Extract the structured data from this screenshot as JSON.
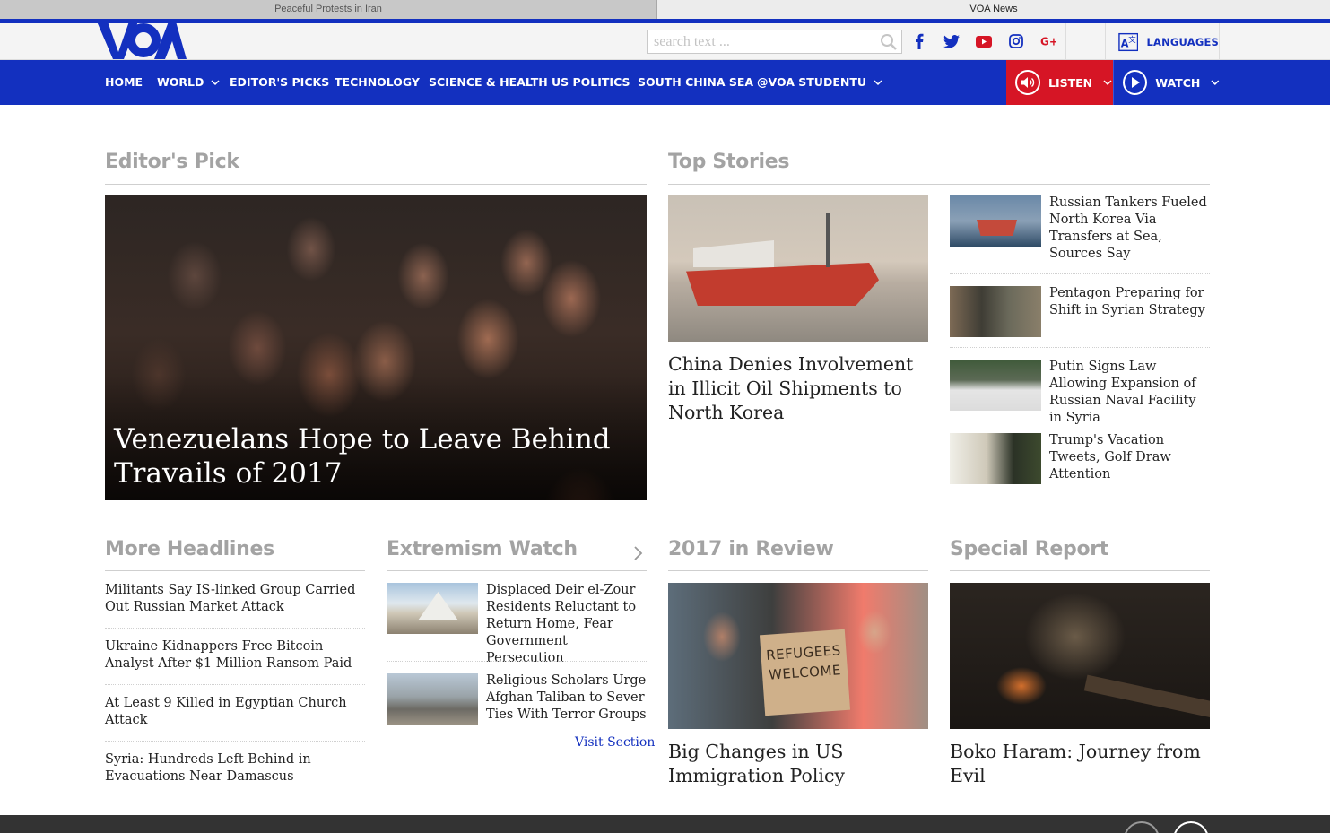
{
  "browser": {
    "tabs": [
      {
        "title": "Peaceful Protests in Iran",
        "active": false
      },
      {
        "title": "VOA News",
        "active": true
      }
    ]
  },
  "header": {
    "logo": "VOA",
    "search_placeholder": "search text ...",
    "social": [
      "facebook-icon",
      "twitter-icon",
      "youtube-icon",
      "instagram-icon",
      "google-plus-icon"
    ],
    "languages_label": "LANGUAGES"
  },
  "nav": {
    "items": [
      {
        "label": "HOME",
        "dropdown": false
      },
      {
        "label": "WORLD",
        "dropdown": true
      },
      {
        "label": "EDITOR'S PICKS",
        "dropdown": false
      },
      {
        "label": "TECHNOLOGY",
        "dropdown": false
      },
      {
        "label": "SCIENCE & HEALTH",
        "dropdown": false
      },
      {
        "label": "US POLITICS",
        "dropdown": false
      },
      {
        "label": "SOUTH CHINA SEA",
        "dropdown": false
      },
      {
        "label": "@VOA STUDENTU",
        "dropdown": true
      }
    ],
    "listen_label": "LISTEN",
    "watch_label": "WATCH"
  },
  "colors": {
    "brand_blue": "#1330bf",
    "listen_red": "#d61525",
    "section_gray": "#a3a3a3"
  },
  "editors_pick": {
    "title": "Editor's Pick",
    "headline": "Venezuelans Hope to Leave Behind Travails of 2017"
  },
  "top_stories": {
    "title": "Top Stories",
    "main_headline": "China Denies Involvement in Illicit Oil Shipments to North Korea",
    "side": [
      "Russian Tankers Fueled North Korea Via Transfers at Sea, Sources Say",
      "Pentagon Preparing for Shift in Syrian Strategy",
      "Putin Signs Law Allowing Expansion of Russian Naval Facility in Syria",
      "Trump's Vacation Tweets, Golf Draw Attention"
    ]
  },
  "more_headlines": {
    "title": "More Headlines",
    "items": [
      "Militants Say IS-linked Group Carried Out Russian Market Attack",
      "Ukraine Kidnappers Free Bitcoin Analyst After $1 Million Ransom Paid",
      "At Least 9 Killed in Egyptian Church Attack",
      "Syria: Hundreds Left Behind in Evacuations Near Damascus"
    ]
  },
  "extremism_watch": {
    "title": "Extremism Watch",
    "items": [
      "Displaced Deir el-Zour Residents Reluctant to Return Home, Fear Government Persecution",
      "Religious Scholars Urge Afghan Taliban to Sever Ties With Terror Groups"
    ],
    "visit_label": "Visit Section"
  },
  "review_2017": {
    "title": "2017 in Review",
    "headline": "Big Changes in US Immigration Policy",
    "sign_text": "REFUGEES WELCOME"
  },
  "special_report": {
    "title": "Special Report",
    "headline": "Boko Haram: Journey from Evil"
  }
}
